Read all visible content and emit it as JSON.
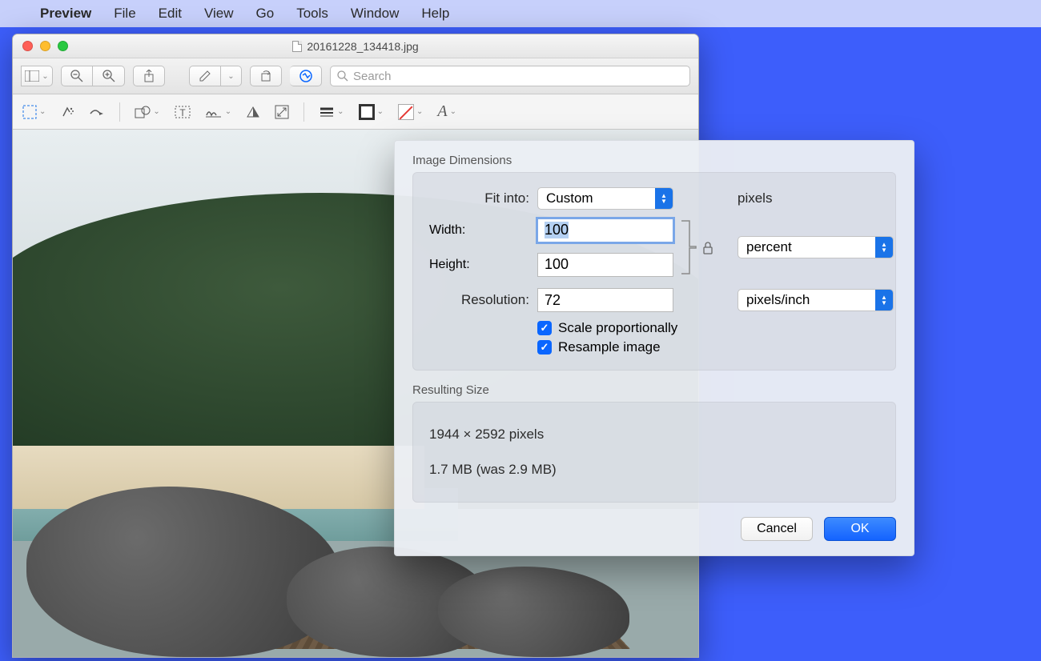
{
  "menubar": {
    "app": "Preview",
    "items": [
      "File",
      "Edit",
      "View",
      "Go",
      "Tools",
      "Window",
      "Help"
    ]
  },
  "window": {
    "title": "20161228_134418.jpg"
  },
  "toolbar": {
    "search_placeholder": "Search"
  },
  "dialog": {
    "section1_title": "Image Dimensions",
    "fit_into_label": "Fit into:",
    "fit_into_value": "Custom",
    "fit_into_suffix": "pixels",
    "width_label": "Width:",
    "width_value": "100",
    "height_label": "Height:",
    "height_value": "100",
    "wh_units": "percent",
    "resolution_label": "Resolution:",
    "resolution_value": "72",
    "resolution_units": "pixels/inch",
    "scale_label": "Scale proportionally",
    "resample_label": "Resample image",
    "section2_title": "Resulting Size",
    "result_dims": "1944 × 2592 pixels",
    "result_size": "1.7 MB (was 2.9 MB)",
    "cancel": "Cancel",
    "ok": "OK"
  }
}
